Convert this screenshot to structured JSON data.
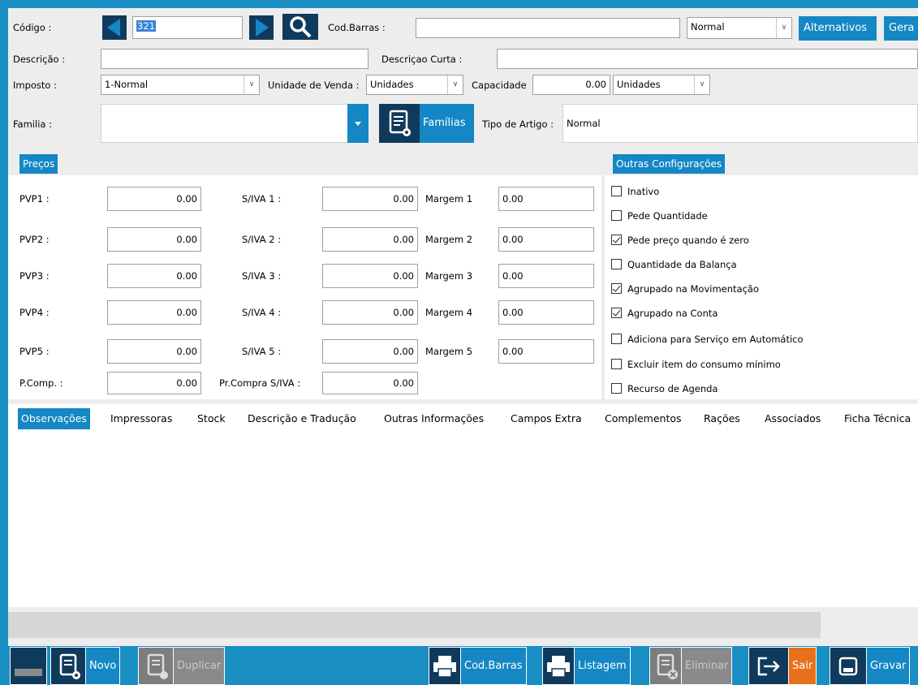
{
  "header": {
    "codigo_label": "Código :",
    "codigo_value": "321",
    "cod_barras_label": "Cod.Barras :",
    "cod_barras_value": "",
    "type_select": "Normal",
    "alternativos_label": "Alternativos",
    "gerar_label": "Gera",
    "descricao_label": "Descrição :",
    "descricao_value": "",
    "descricao_curta_label": "Descriçao Curta :",
    "descricao_curta_value": "",
    "imposto_label": "Imposto :",
    "imposto_value": "1-Normal",
    "unidade_venda_label": "Unidade de Venda :",
    "unidade_venda_value": "Unidades",
    "capacidade_label": "Capacidade",
    "capacidade_value": "0.00",
    "capacidade_unit": "Unidades",
    "familia_label": "Familia :",
    "familia_value": "",
    "familias_button": "Famílias",
    "tipo_artigo_label": "Tipo de Artigo :",
    "tipo_artigo_value": "Normal"
  },
  "precos": {
    "title": "Preços",
    "rows": [
      {
        "label": "PVP1 :",
        "value": "0.00",
        "siva_label": "S/IVA 1 :",
        "siva_value": "0.00",
        "margem_label": "Margem 1",
        "margem_value": "0.00"
      },
      {
        "label": "PVP2 :",
        "value": "0.00",
        "siva_label": "S/IVA 2 :",
        "siva_value": "0.00",
        "margem_label": "Margem 2",
        "margem_value": "0.00"
      },
      {
        "label": "PVP3 :",
        "value": "0.00",
        "siva_label": "S/IVA 3 :",
        "siva_value": "0.00",
        "margem_label": "Margem 3",
        "margem_value": "0.00"
      },
      {
        "label": "PVP4 :",
        "value": "0.00",
        "siva_label": "S/IVA 4 :",
        "siva_value": "0.00",
        "margem_label": "Margem 4",
        "margem_value": "0.00"
      },
      {
        "label": "PVP5 :",
        "value": "0.00",
        "siva_label": "S/IVA 5 :",
        "siva_value": "0.00",
        "margem_label": "Margem 5",
        "margem_value": "0.00"
      }
    ],
    "pcomp_label": "P.Comp. :",
    "pcomp_value": "0.00",
    "prcompra_label": "Pr.Compra S/IVA :",
    "prcompra_value": "0.00"
  },
  "outras": {
    "title": "Outras Configurações",
    "options": [
      {
        "label": "Inativo",
        "checked": false
      },
      {
        "label": "Pede Quantidade",
        "checked": false
      },
      {
        "label": "Pede preço quando é zero",
        "checked": true
      },
      {
        "label": "Quantidade da Balança",
        "checked": false
      },
      {
        "label": "Agrupado na Movimentação",
        "checked": true
      },
      {
        "label": "Agrupado na Conta",
        "checked": true
      },
      {
        "label": "Adiciona para Serviço em Automático",
        "checked": false
      },
      {
        "label": "Excluir item do consumo mínimo",
        "checked": false
      },
      {
        "label": "Recurso de Agenda",
        "checked": false
      }
    ]
  },
  "tabs": [
    {
      "label": "Observações",
      "active": true
    },
    {
      "label": "Impressoras"
    },
    {
      "label": "Stock"
    },
    {
      "label": "Descrição e Tradução"
    },
    {
      "label": "Outras Informações"
    },
    {
      "label": "Campos Extra"
    },
    {
      "label": "Complementos"
    },
    {
      "label": "Rações"
    },
    {
      "label": "Associados"
    },
    {
      "label": "Ficha Técnica"
    }
  ],
  "toolbar": {
    "novo": "Novo",
    "duplicar": "Duplicar",
    "cod_barras": "Cod.Barras",
    "listagem": "Listagem",
    "eliminar": "Eliminar",
    "sair": "Sair",
    "gravar": "Gravar"
  }
}
